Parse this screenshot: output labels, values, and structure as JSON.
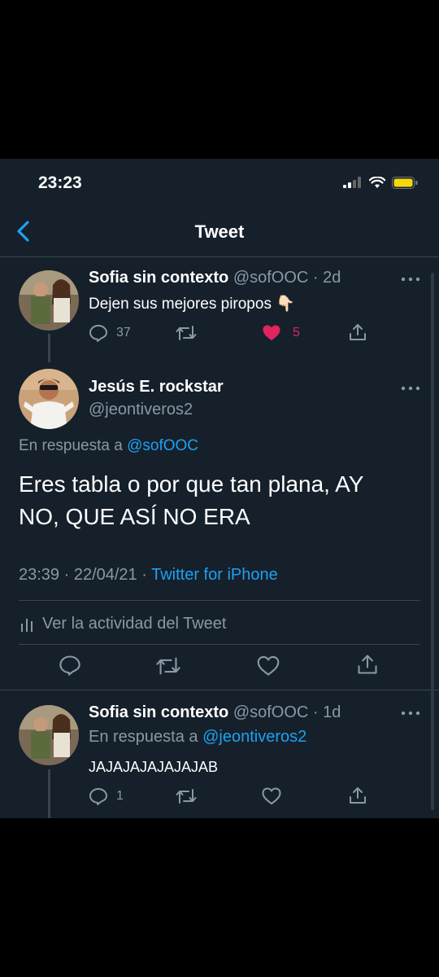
{
  "status_bar": {
    "time": "23:23"
  },
  "nav": {
    "title": "Tweet"
  },
  "parent_tweet": {
    "name": "Sofia sin contexto",
    "meta": "@sofOOC · 2d",
    "text": "Dejen sus mejores piropos 👇🏻",
    "replies": "37",
    "likes": "5"
  },
  "main_tweet": {
    "name": "Jesús E. rockstar",
    "handle": "@jeontiveros2",
    "reply_prefix": "En respuesta a",
    "reply_to": "@sofOOC",
    "text": "Eres tabla o por que tan plana, AY NO, QUE ASÍ NO ERA",
    "timestamp": "23:39 · 22/04/21 ·",
    "source": "Twitter for iPhone",
    "activity_label": "Ver la actividad del Tweet"
  },
  "reply_tweet": {
    "name": "Sofia sin contexto",
    "meta": "@sofOOC · 1d",
    "reply_prefix": "En respuesta a",
    "reply_to": "@jeontiveros2",
    "text": "JAJAJAJAJAJAJAB",
    "replies": "1"
  },
  "colors": {
    "background": "#15202b",
    "accent": "#1da1f2",
    "like": "#e0245e",
    "muted": "#8899a6",
    "border": "#38444d"
  }
}
